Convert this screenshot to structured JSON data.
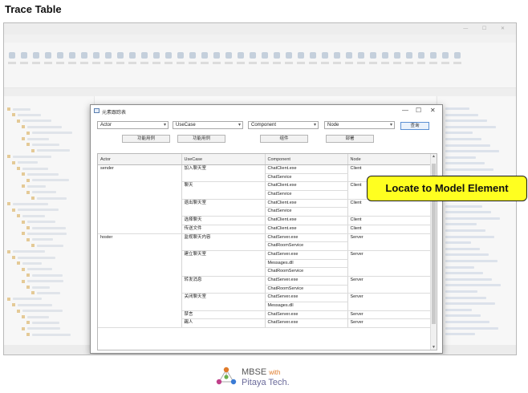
{
  "page_title": "Trace Table",
  "dialog": {
    "title": "元素跟踪表",
    "controls": [
      "—",
      "☐",
      "✕"
    ],
    "filters": [
      {
        "value": "Actor"
      },
      {
        "value": "UseCase"
      },
      {
        "value": "Component"
      },
      {
        "value": "Node"
      }
    ],
    "query_label": "查询",
    "buttons": [
      "功能用例",
      "功能用例",
      "组件",
      "部署"
    ],
    "columns": [
      "Actor",
      "UseCase",
      "Component",
      "Node"
    ],
    "rows": [
      {
        "actor": "sender",
        "usecase": "加入聊天室",
        "component": "ChatClient.exe",
        "node": "Client"
      },
      {
        "actor": "",
        "usecase": "",
        "component": "ChatService",
        "node": ""
      },
      {
        "actor": "",
        "usecase": "聊天",
        "component": "ChatClient.exe",
        "node": "Client"
      },
      {
        "actor": "",
        "usecase": "",
        "component": "ChatService",
        "node": ""
      },
      {
        "actor": "",
        "usecase": "退出聊天室",
        "component": "ChatClient.exe",
        "node": "Client"
      },
      {
        "actor": "",
        "usecase": "",
        "component": "ChatService",
        "node": ""
      },
      {
        "actor": "",
        "usecase": "选择聊天",
        "component": "ChatClient.exe",
        "node": "Client"
      },
      {
        "actor": "",
        "usecase": "传送文件",
        "component": "ChatClient.exe",
        "node": "Client"
      },
      {
        "actor": "hoster",
        "usecase": "监视聊天内容",
        "component": "ChatServer.exe",
        "node": "Server"
      },
      {
        "actor": "",
        "usecase": "",
        "component": "ChatRoomService",
        "node": ""
      },
      {
        "actor": "",
        "usecase": "建立聊天室",
        "component": "ChatServer.exe",
        "node": "Server"
      },
      {
        "actor": "",
        "usecase": "",
        "component": "Messages.dll",
        "node": ""
      },
      {
        "actor": "",
        "usecase": "",
        "component": "ChatRoomService",
        "node": ""
      },
      {
        "actor": "",
        "usecase": "转发消息",
        "component": "ChatServer.exe",
        "node": "Server"
      },
      {
        "actor": "",
        "usecase": "",
        "component": "ChatRoomService",
        "node": ""
      },
      {
        "actor": "",
        "usecase": "关闭聊天室",
        "component": "ChatServer.exe",
        "node": "Server"
      },
      {
        "actor": "",
        "usecase": "",
        "component": "Messages.dll",
        "node": ""
      },
      {
        "actor": "",
        "usecase": "禁言",
        "component": "ChatServer.exe",
        "node": "Server"
      },
      {
        "actor": "",
        "usecase": "踢人",
        "component": "ChatServer.exe",
        "node": "Server"
      }
    ]
  },
  "callout": "Locate to Model  Element",
  "brand": {
    "name": "MBSE",
    "with": "with",
    "company": "Pitaya Tech."
  },
  "colors": {
    "callout_bg": "#ffff20",
    "accent": "#5b8fd3"
  }
}
